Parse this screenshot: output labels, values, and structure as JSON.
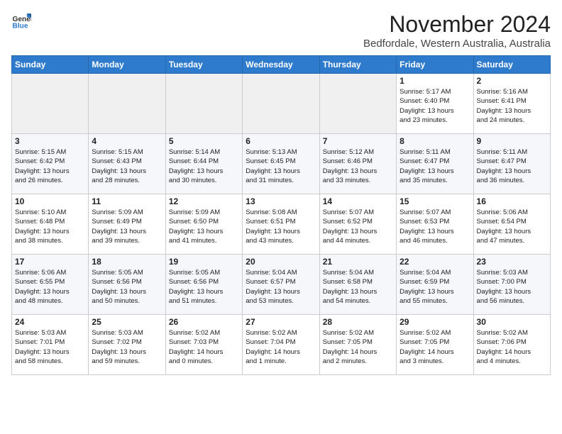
{
  "logo": {
    "line1": "General",
    "line2": "Blue"
  },
  "title": "November 2024",
  "subtitle": "Bedfordale, Western Australia, Australia",
  "weekdays": [
    "Sunday",
    "Monday",
    "Tuesday",
    "Wednesday",
    "Thursday",
    "Friday",
    "Saturday"
  ],
  "weeks": [
    [
      {
        "day": "",
        "info": ""
      },
      {
        "day": "",
        "info": ""
      },
      {
        "day": "",
        "info": ""
      },
      {
        "day": "",
        "info": ""
      },
      {
        "day": "",
        "info": ""
      },
      {
        "day": "1",
        "info": "Sunrise: 5:17 AM\nSunset: 6:40 PM\nDaylight: 13 hours\nand 23 minutes."
      },
      {
        "day": "2",
        "info": "Sunrise: 5:16 AM\nSunset: 6:41 PM\nDaylight: 13 hours\nand 24 minutes."
      }
    ],
    [
      {
        "day": "3",
        "info": "Sunrise: 5:15 AM\nSunset: 6:42 PM\nDaylight: 13 hours\nand 26 minutes."
      },
      {
        "day": "4",
        "info": "Sunrise: 5:15 AM\nSunset: 6:43 PM\nDaylight: 13 hours\nand 28 minutes."
      },
      {
        "day": "5",
        "info": "Sunrise: 5:14 AM\nSunset: 6:44 PM\nDaylight: 13 hours\nand 30 minutes."
      },
      {
        "day": "6",
        "info": "Sunrise: 5:13 AM\nSunset: 6:45 PM\nDaylight: 13 hours\nand 31 minutes."
      },
      {
        "day": "7",
        "info": "Sunrise: 5:12 AM\nSunset: 6:46 PM\nDaylight: 13 hours\nand 33 minutes."
      },
      {
        "day": "8",
        "info": "Sunrise: 5:11 AM\nSunset: 6:47 PM\nDaylight: 13 hours\nand 35 minutes."
      },
      {
        "day": "9",
        "info": "Sunrise: 5:11 AM\nSunset: 6:47 PM\nDaylight: 13 hours\nand 36 minutes."
      }
    ],
    [
      {
        "day": "10",
        "info": "Sunrise: 5:10 AM\nSunset: 6:48 PM\nDaylight: 13 hours\nand 38 minutes."
      },
      {
        "day": "11",
        "info": "Sunrise: 5:09 AM\nSunset: 6:49 PM\nDaylight: 13 hours\nand 39 minutes."
      },
      {
        "day": "12",
        "info": "Sunrise: 5:09 AM\nSunset: 6:50 PM\nDaylight: 13 hours\nand 41 minutes."
      },
      {
        "day": "13",
        "info": "Sunrise: 5:08 AM\nSunset: 6:51 PM\nDaylight: 13 hours\nand 43 minutes."
      },
      {
        "day": "14",
        "info": "Sunrise: 5:07 AM\nSunset: 6:52 PM\nDaylight: 13 hours\nand 44 minutes."
      },
      {
        "day": "15",
        "info": "Sunrise: 5:07 AM\nSunset: 6:53 PM\nDaylight: 13 hours\nand 46 minutes."
      },
      {
        "day": "16",
        "info": "Sunrise: 5:06 AM\nSunset: 6:54 PM\nDaylight: 13 hours\nand 47 minutes."
      }
    ],
    [
      {
        "day": "17",
        "info": "Sunrise: 5:06 AM\nSunset: 6:55 PM\nDaylight: 13 hours\nand 48 minutes."
      },
      {
        "day": "18",
        "info": "Sunrise: 5:05 AM\nSunset: 6:56 PM\nDaylight: 13 hours\nand 50 minutes."
      },
      {
        "day": "19",
        "info": "Sunrise: 5:05 AM\nSunset: 6:56 PM\nDaylight: 13 hours\nand 51 minutes."
      },
      {
        "day": "20",
        "info": "Sunrise: 5:04 AM\nSunset: 6:57 PM\nDaylight: 13 hours\nand 53 minutes."
      },
      {
        "day": "21",
        "info": "Sunrise: 5:04 AM\nSunset: 6:58 PM\nDaylight: 13 hours\nand 54 minutes."
      },
      {
        "day": "22",
        "info": "Sunrise: 5:04 AM\nSunset: 6:59 PM\nDaylight: 13 hours\nand 55 minutes."
      },
      {
        "day": "23",
        "info": "Sunrise: 5:03 AM\nSunset: 7:00 PM\nDaylight: 13 hours\nand 56 minutes."
      }
    ],
    [
      {
        "day": "24",
        "info": "Sunrise: 5:03 AM\nSunset: 7:01 PM\nDaylight: 13 hours\nand 58 minutes."
      },
      {
        "day": "25",
        "info": "Sunrise: 5:03 AM\nSunset: 7:02 PM\nDaylight: 13 hours\nand 59 minutes."
      },
      {
        "day": "26",
        "info": "Sunrise: 5:02 AM\nSunset: 7:03 PM\nDaylight: 14 hours\nand 0 minutes."
      },
      {
        "day": "27",
        "info": "Sunrise: 5:02 AM\nSunset: 7:04 PM\nDaylight: 14 hours\nand 1 minute."
      },
      {
        "day": "28",
        "info": "Sunrise: 5:02 AM\nSunset: 7:05 PM\nDaylight: 14 hours\nand 2 minutes."
      },
      {
        "day": "29",
        "info": "Sunrise: 5:02 AM\nSunset: 7:05 PM\nDaylight: 14 hours\nand 3 minutes."
      },
      {
        "day": "30",
        "info": "Sunrise: 5:02 AM\nSunset: 7:06 PM\nDaylight: 14 hours\nand 4 minutes."
      }
    ]
  ]
}
